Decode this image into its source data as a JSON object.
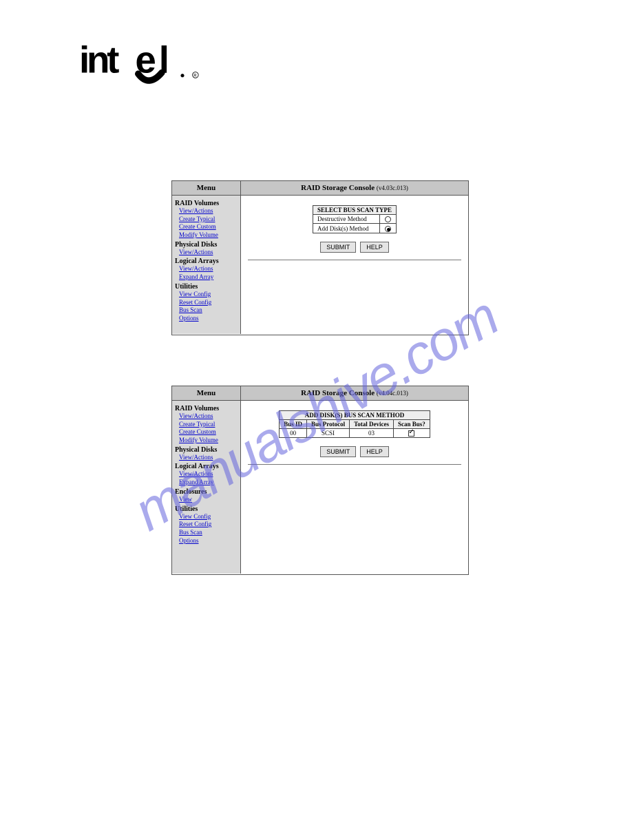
{
  "logo": {
    "alt": "intel"
  },
  "watermark": "manualshive.com",
  "console1": {
    "menu_label": "Menu",
    "title_bold": "RAID Storage Console",
    "title_ver": "(v4.03c.013)",
    "sidebar": {
      "cat1": "RAID Volumes",
      "links1": [
        "View/Actions",
        "Create Typical",
        "Create Custom",
        "Modify Volume"
      ],
      "cat2": "Physical Disks",
      "links2": [
        "View/Actions"
      ],
      "cat3": "Logical Arrays",
      "links3": [
        "View/Actions",
        "Expand Array"
      ],
      "cat4": "Utilities",
      "links4": [
        "View Config",
        "Reset Config",
        "Bus Scan",
        "Options"
      ]
    },
    "main": {
      "table_title": "SELECT BUS SCAN TYPE",
      "row1": "Destructive Method",
      "row2": "Add Disk(s) Method",
      "submit": "SUBMIT",
      "help": "HELP"
    }
  },
  "console2": {
    "menu_label": "Menu",
    "title_bold": "RAID Storage Console",
    "title_ver": "(v4.04c.013)",
    "sidebar": {
      "cat1": "RAID Volumes",
      "links1": [
        "View/Actions",
        "Create Typical",
        "Create Custom",
        "Modify Volume"
      ],
      "cat2": "Physical Disks",
      "links2": [
        "View/Actions"
      ],
      "cat3": "Logical Arrays",
      "links3": [
        "View/Actions",
        "Expand Array"
      ],
      "cat4": "Enclosures",
      "links4": [
        "View"
      ],
      "cat5": "Utilities",
      "links5": [
        "View Config",
        "Reset Config",
        "Bus Scan",
        "Options"
      ]
    },
    "main": {
      "table_title": "ADD DISK(S) BUS SCAN METHOD",
      "headers": [
        "Bus ID",
        "Bus Protocol",
        "Total Devices",
        "Scan Bus?"
      ],
      "row": [
        "00",
        "SCSI",
        "03"
      ],
      "submit": "SUBMIT",
      "help": "HELP"
    }
  }
}
